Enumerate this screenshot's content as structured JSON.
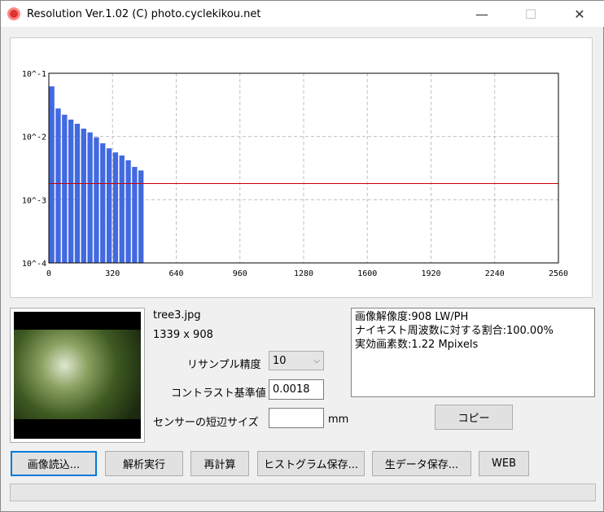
{
  "window": {
    "title": "Resolution Ver.1.02 (C) photo.cyclekikou.net",
    "minimize": "—",
    "maximize": "☐",
    "close": "✕"
  },
  "chart_data": {
    "type": "bar",
    "x": [
      0,
      32,
      64,
      96,
      128,
      160,
      192,
      224,
      256,
      288,
      320,
      352,
      384,
      416,
      448
    ],
    "values": [
      0.062,
      0.0277,
      0.0221,
      0.0185,
      0.0159,
      0.0133,
      0.0116,
      0.0097,
      0.0078,
      0.0065,
      0.0056,
      0.005,
      0.0042,
      0.0033,
      0.0029
    ],
    "bar_width": 32,
    "threshold": 0.0018,
    "xlim": [
      0,
      2560
    ],
    "ylim": [
      0.0001,
      0.1
    ],
    "yscale": "log",
    "xticks": [
      "0",
      "320",
      "640",
      "960",
      "1280",
      "1600",
      "1920",
      "2240",
      "2560"
    ],
    "yticks": [
      "10^-1",
      "10^-2",
      "10^-3",
      "10^-4"
    ],
    "colors": {
      "bar": "#4169e1",
      "threshold": "#cc0000",
      "grid": "#c0c0c0"
    }
  },
  "file": {
    "name": "tree3.jpg",
    "size": "1339 x 908"
  },
  "settings": {
    "resample_label": "リサンプル精度",
    "resample_value": "10",
    "contrast_label": "コントラスト基準値",
    "contrast_value": "0.0018",
    "sensor_label": "センサーの短辺サイズ",
    "sensor_value": "",
    "sensor_unit": "mm"
  },
  "results": [
    "画像解像度:908 LW/PH",
    "ナイキスト周波数に対する割合:100.00%",
    "実効画素数:1.22 Mpixels"
  ],
  "buttons": {
    "copy": "コピー",
    "load": "画像読込...",
    "analyze": "解析実行",
    "recalc": "再計算",
    "save_hist": "ヒストグラム保存...",
    "save_raw": "生データ保存...",
    "web": "WEB"
  }
}
